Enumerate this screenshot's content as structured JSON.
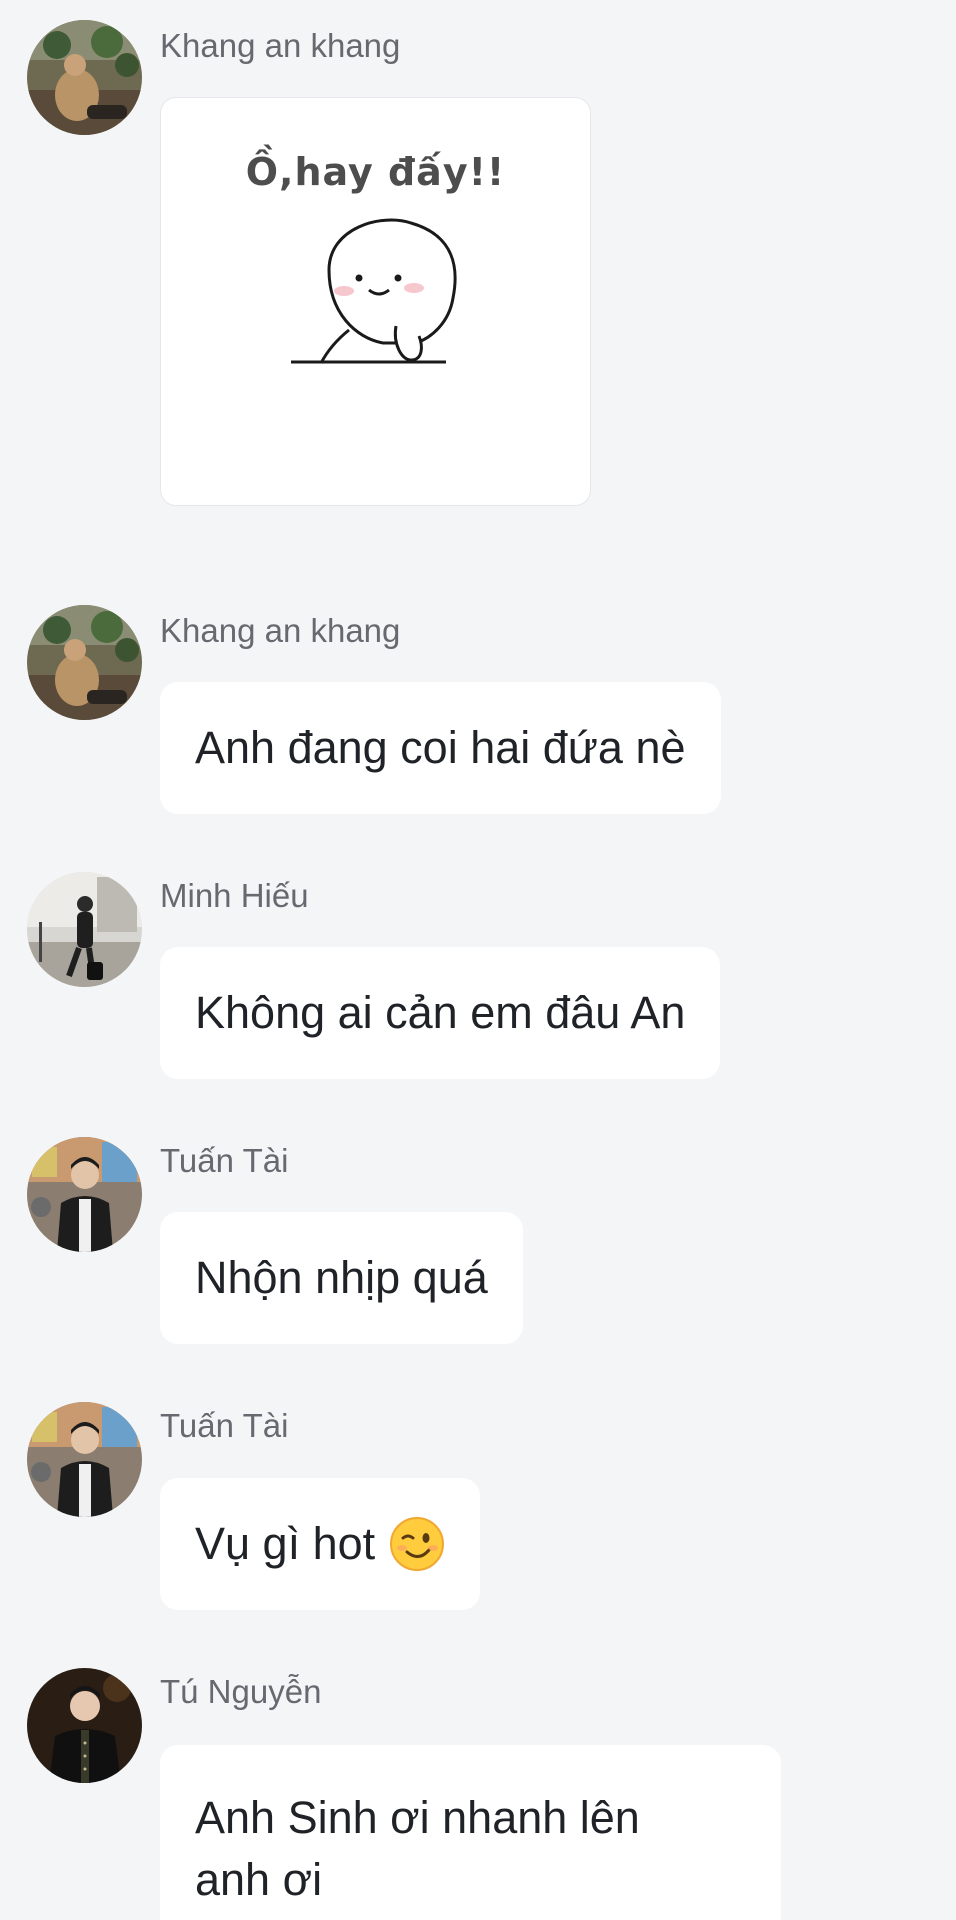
{
  "messages": [
    {
      "sender": "Khang an khang",
      "type": "sticker",
      "sticker_caption": "Ồ,hay đấy!!"
    },
    {
      "sender": "Khang an khang",
      "type": "text",
      "text": "Anh đang coi hai đứa nè"
    },
    {
      "sender": "Minh Hiếu",
      "type": "text",
      "text": "Không ai cản em đâu An"
    },
    {
      "sender": "Tuấn Tài",
      "type": "text",
      "text": "Nhộn nhịp quá"
    },
    {
      "sender": "Tuấn Tài",
      "type": "text",
      "text": "Vụ gì hot",
      "emoji": "winking-face"
    },
    {
      "sender": "Tú Nguyễn",
      "type": "text",
      "text": "Anh Sinh ơi nhanh lên\nanh ơi"
    }
  ],
  "colors": {
    "background": "#f4f5f7",
    "bubble": "#ffffff",
    "sender_text": "#666a70",
    "message_text": "#1f2227"
  }
}
